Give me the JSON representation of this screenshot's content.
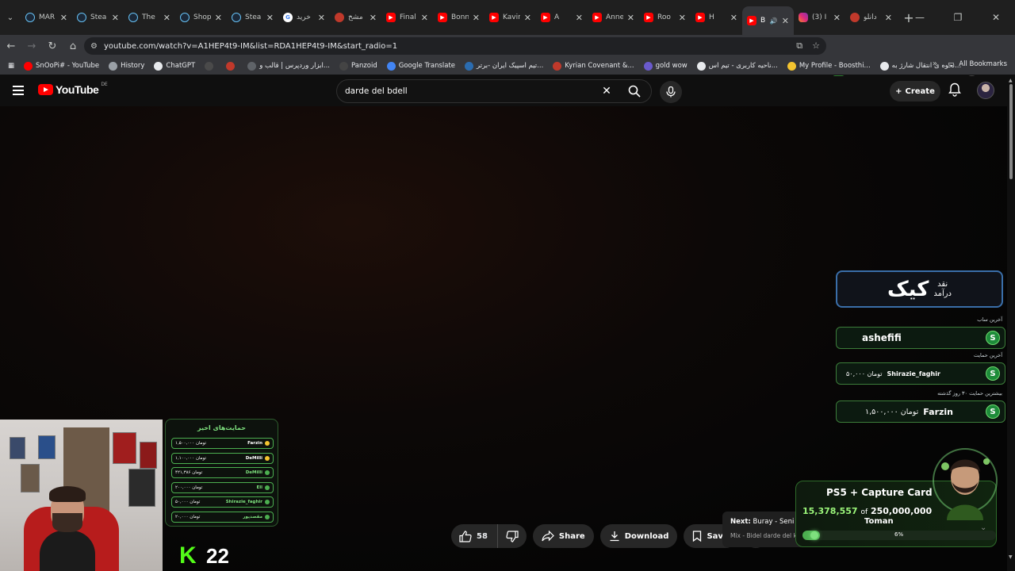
{
  "tabs": [
    {
      "label": "MAR",
      "icon": "steam-icon"
    },
    {
      "label": "Stea",
      "icon": "steam-icon"
    },
    {
      "label": "The",
      "icon": "steam-icon"
    },
    {
      "label": "Shop",
      "icon": "steam-icon"
    },
    {
      "label": "Stea",
      "icon": "steam-icon"
    },
    {
      "label": "خرید",
      "icon": "google-icon"
    },
    {
      "label": "مشخ",
      "icon": "site-icon"
    },
    {
      "label": "Final",
      "icon": "youtube-icon"
    },
    {
      "label": "Bonn",
      "icon": "youtube-icon"
    },
    {
      "label": "Kavir",
      "icon": "youtube-icon"
    },
    {
      "label": "A",
      "icon": "youtube-icon"
    },
    {
      "label": "Anne",
      "icon": "youtube-icon"
    },
    {
      "label": "Roo",
      "icon": "youtube-icon"
    },
    {
      "label": "H",
      "icon": "youtube-icon"
    },
    {
      "label": "B",
      "icon": "youtube-icon",
      "active": true
    },
    {
      "label": "(3) I",
      "icon": "instagram-icon"
    },
    {
      "label": "دانلو",
      "icon": "site-icon"
    }
  ],
  "address": {
    "url": "youtube.com/watch?v=A1HEP4t9-IM&list=RDA1HEP4t9-IM&start_radio=1"
  },
  "bookmarks": [
    "SnOoPi# - YouTube",
    "History",
    "ChatGPT",
    "",
    "",
    "ابزار وردپرس | قالب و...",
    "Panzoid",
    "Google Translate",
    "تیم اسپیک ایران -برتر...",
    "Kyrian Covenant &...",
    "gold wow",
    "ناحیه کاربری - تیم اس...",
    "My Profile - Boosthi...",
    "نحوه ی انتقال شارژ به..."
  ],
  "all_bookmarks": "All Bookmarks",
  "youtube": {
    "logo_text": "YouTube",
    "region": "DE",
    "search_query": "darde del bdell",
    "create_label": "Create"
  },
  "widgets": {
    "kick_big": "کیک",
    "kick_small_1": "نقد",
    "kick_small_2": "درآمد",
    "last_sub_label": "آخرین ساب",
    "last_sub_name": "ashefifi",
    "last_support_label": "آخرین حمایت",
    "last_support_name": "Shirazie_faghir",
    "last_support_amount": "۵۰,۰۰۰ تومان",
    "top_support_label": "بیشترین حمایت ۳۰ روز گذشته",
    "top_support_name": "Farzin",
    "top_support_amount": "۱,۵۰۰,۰۰۰ تومان",
    "coin_letter": "S"
  },
  "donations": {
    "title": "حمایت‌های اخیر",
    "rows": [
      {
        "amount": "۱,۵۰۰,۰۰۰ تومان",
        "name": "Farzin",
        "dot": "gold"
      },
      {
        "amount": "۱,۱۰۰,۰۰۰ تومان",
        "name": "DeMilli",
        "dot": "gold"
      },
      {
        "amount": "۴۲۱,۳۸۶ تومان",
        "name": "DeMilli",
        "dot": "green"
      },
      {
        "amount": "۲۰۰,۰۰۰ تومان",
        "name": "Ell",
        "dot": "green"
      },
      {
        "amount": "۵۰,۰۰۰ تومان",
        "name": "Shirazie_faghir",
        "dot": "green"
      },
      {
        "amount": "۲۰,۰۰۰ تومان",
        "name": "مقصدپور",
        "dot": "green"
      }
    ]
  },
  "kick_logo": "K",
  "kick_count": "22",
  "actions": {
    "likes": "58",
    "share": "Share",
    "download": "Download",
    "save": "Save"
  },
  "next_up": {
    "prefix": "Next:",
    "title": "Buray - Seni Sevmiyorum Artık",
    "subtitle": "Mix - Bidel darde del kun..."
  },
  "goal": {
    "title": "PS5 + Capture Card",
    "current": "15,378,557",
    "of": "of",
    "target": "250,000,000",
    "unit": "Toman",
    "percent_label": "6%",
    "progress": 0.06
  },
  "colors": {
    "youtube_red": "#ff0000",
    "kick_green": "#53fc18"
  }
}
